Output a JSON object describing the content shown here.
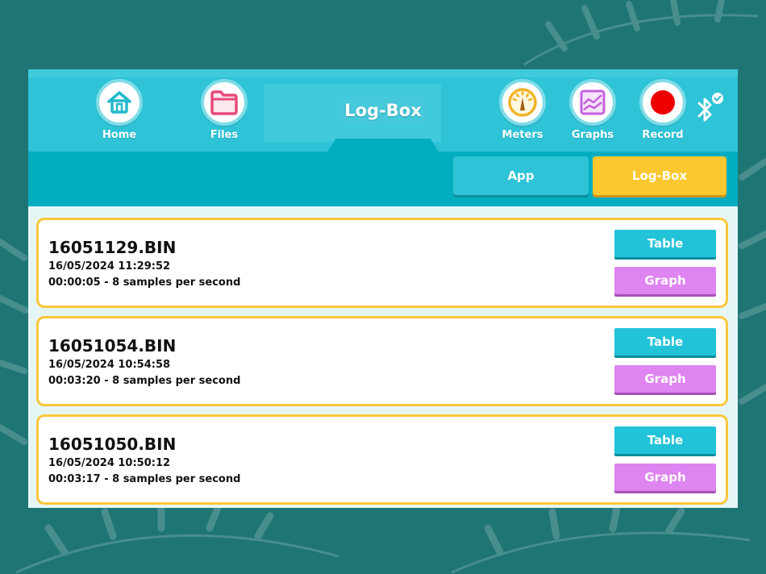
{
  "nav": {
    "home_label": "Home",
    "files_label": "Files",
    "title": "Log-Box",
    "meters_label": "Meters",
    "graphs_label": "Graphs",
    "record_label": "Record"
  },
  "segments": {
    "app_label": "App",
    "logbox_label": "Log-Box"
  },
  "files": [
    {
      "name": "16051129.BIN",
      "date": "16/05/2024 11:29:52",
      "info": "00:00:05 - 8 samples per second",
      "table_label": "Table",
      "graph_label": "Graph"
    },
    {
      "name": "16051054.BIN",
      "date": "16/05/2024 10:54:58",
      "info": "00:03:20 - 8 samples per second",
      "table_label": "Table",
      "graph_label": "Graph"
    },
    {
      "name": "16051050.BIN",
      "date": "16/05/2024 10:50:12",
      "info": "00:03:17 - 8 samples per second",
      "table_label": "Table",
      "graph_label": "Graph"
    }
  ],
  "colors": {
    "background": "#1e7574",
    "topbar": "#2ec3d6",
    "subbar": "#03adc0",
    "accent_yellow": "#fdc82f",
    "graph_purple": "#de85f1",
    "record_red": "#ee0000",
    "files_pink": "#e94a7a"
  },
  "icons": [
    "house-icon",
    "folder-icon",
    "gauge-icon",
    "graph-icon",
    "record-icon",
    "bluetooth-connected-icon"
  ]
}
